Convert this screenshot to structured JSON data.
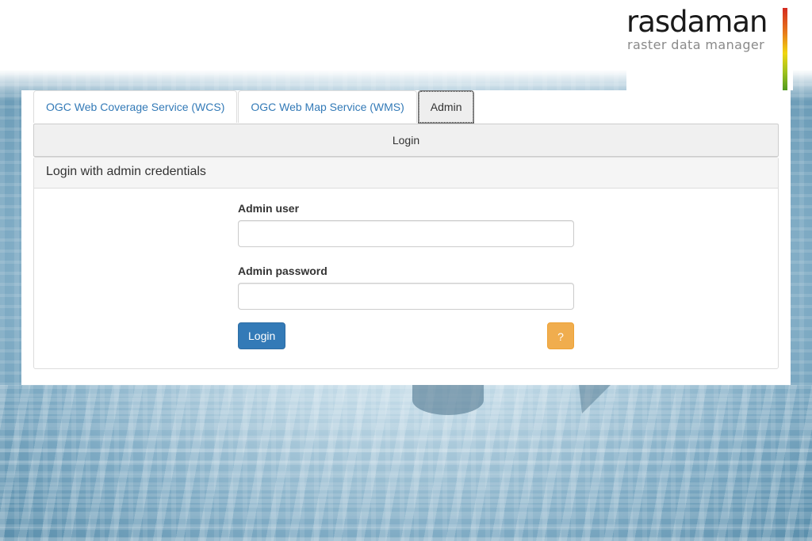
{
  "logo": {
    "title": "rasdaman",
    "subtitle": "raster data manager"
  },
  "tabs": [
    {
      "label": "OGC Web Coverage Service (WCS)",
      "active": false
    },
    {
      "label": "OGC Web Map Service (WMS)",
      "active": false
    },
    {
      "label": "Admin",
      "active": true
    }
  ],
  "subtab": {
    "label": "Login"
  },
  "panel": {
    "heading": "Login with admin credentials"
  },
  "form": {
    "user_label": "Admin user",
    "user_value": "",
    "password_label": "Admin password",
    "password_value": "",
    "login_button": "Login",
    "help_button": "?"
  },
  "colors": {
    "primary": "#337ab7",
    "warning": "#f0ad4e",
    "tab_active_bg": "#eeeeee"
  }
}
